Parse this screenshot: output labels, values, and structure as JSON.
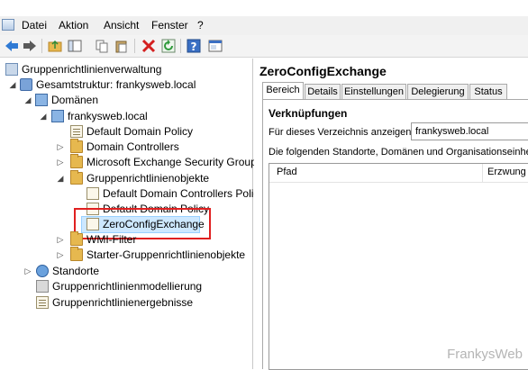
{
  "menubar": {
    "items": [
      "Datei",
      "Aktion",
      "Ansicht",
      "Fenster",
      "?"
    ]
  },
  "toolbar": {
    "buttons": [
      "back-arrow-icon",
      "forward-arrow-icon",
      "folder-up-icon",
      "show-hide-tree-icon",
      "copy-icon",
      "paste-icon",
      "delete-icon",
      "refresh-icon",
      "help-icon",
      "console-icon"
    ],
    "colors": {
      "back": "#2f7ad4",
      "delete": "#d42020",
      "refresh": "#2e9a3a"
    }
  },
  "tree": {
    "root": "Gruppenrichtlinienverwaltung",
    "forest": "Gesamtstruktur: frankysweb.local",
    "domains": "Domänen",
    "domain": "frankysweb.local",
    "items": {
      "default_domain_policy": "Default Domain Policy",
      "domain_controllers": "Domain Controllers",
      "exchange_groups": "Microsoft Exchange Security Groups",
      "gpo_container": "Gruppenrichtlinienobjekte",
      "dc_policy": "Default Domain Controllers Polic",
      "domain_policy_2": "Default Domain Policy",
      "zeroconf": "ZeroConfigExchange",
      "wmi": "WMI-Filter",
      "starter": "Starter-Gruppenrichtlinienobjekte"
    },
    "sites": "Standorte",
    "modeling": "Gruppenrichtlinienmodellierung",
    "results": "Gruppenrichtlinienergebnisse"
  },
  "details": {
    "title": "ZeroConfigExchange",
    "tabs": [
      "Bereich",
      "Details",
      "Einstellungen",
      "Delegierung",
      "Status"
    ],
    "active_tab": "Bereich",
    "links_heading": "Verknüpfungen",
    "show_links_label": "Für dieses Verzeichnis anzeigen:",
    "show_links_value": "frankysweb.local",
    "info_text": "Die folgenden Standorte, Domänen und Organisationseinheiten",
    "columns": [
      "Pfad",
      "Erzwung"
    ]
  },
  "watermark": "FrankysWeb"
}
